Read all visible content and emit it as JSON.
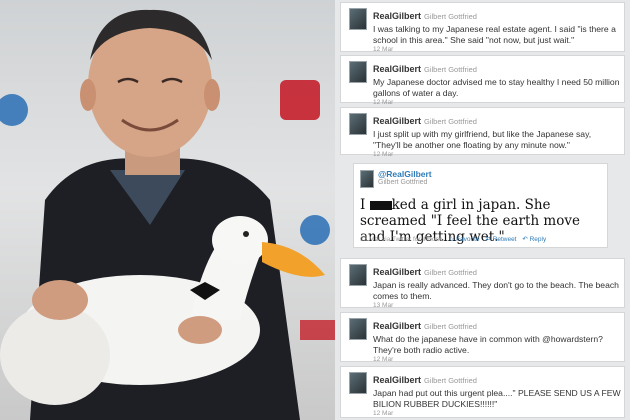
{
  "tweets": [
    {
      "username": "RealGilbert",
      "fullname": "Gilbert Gottfried",
      "text": "I was talking to my Japanese real estate agent. I said \"is there a school in this area.\" She said \"not now, but just wait.\"",
      "date": "12 Mar"
    },
    {
      "username": "RealGilbert",
      "fullname": "Gilbert Gottfried",
      "text": "My Japanese doctor advised me to stay healthy I need 50 million gallons of water a day.",
      "date": "12 Mar"
    },
    {
      "username": "RealGilbert",
      "fullname": "Gilbert Gottfried",
      "text": "I just split up with my girlfriend, but like the Japanese say, \"They'll be another one floating by any minute now.\"",
      "date": "12 Mar"
    },
    {
      "username": "RealGilbert",
      "fullname": "Gilbert Gottfried",
      "text": "Japan is really advanced. They don't go to the beach. The beach comes to them.",
      "date": "13 Mar"
    },
    {
      "username": "RealGilbert",
      "fullname": "Gilbert Gottfried",
      "text": "What do the japanese have in common with @howardstern? They're both radio active.",
      "date": "12 Mar"
    },
    {
      "username": "RealGilbert",
      "fullname": "Gilbert Gottfried",
      "text": "Japan had put out this urgent plea....\" PLEASE SEND US A FEW BILION RUBBER DUCKIES!!!!!!\"",
      "date": "12 Mar"
    }
  ],
  "featured": {
    "handle": "@RealGilbert",
    "fullname": "Gilbert Gottfried",
    "text_before": "I ",
    "text_after": "ked a girl in japan. She screamed \"I feel the earth move and I'm getting wet.\"",
    "meta": "12 Mar via Twitter for iPhone",
    "favorite": "Favorite",
    "retweet": "Retweet",
    "reply": "Reply"
  },
  "colors": {
    "link": "#2e7bb8",
    "duck_beak": "#f2a12b",
    "jacket": "#1d1f24"
  }
}
